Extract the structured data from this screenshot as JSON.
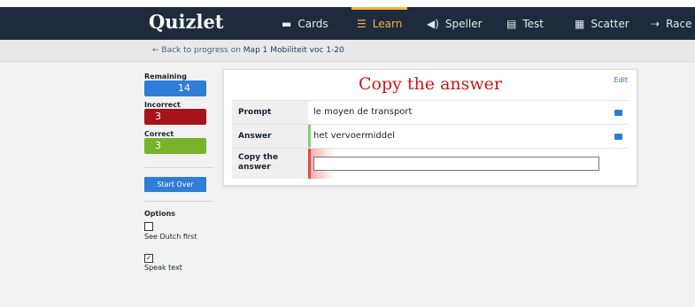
{
  "app": {
    "logo": "Quizlet"
  },
  "nav": [
    {
      "icon": "cards-icon",
      "glyph": "▬",
      "label": "Cards",
      "active": false
    },
    {
      "icon": "learn-icon",
      "glyph": "☰",
      "label": "Learn",
      "active": true
    },
    {
      "icon": "speaker-icon",
      "glyph": "◀)",
      "label": "Speller",
      "active": false
    },
    {
      "icon": "document-icon",
      "glyph": "▤",
      "label": "Test",
      "active": false
    },
    {
      "icon": "scatter-icon",
      "glyph": "▦",
      "label": "Scatter",
      "active": false
    },
    {
      "icon": "race-icon",
      "glyph": "⇢",
      "label": "Race",
      "active": false
    }
  ],
  "subbar": {
    "back_text": "← Back to progress on ",
    "set_name": "Map 1 Mobiliteit voc 1-20"
  },
  "sidebar": {
    "remaining_label": "Remaining",
    "remaining_value": "14",
    "incorrect_label": "Incorrect",
    "incorrect_value": "3",
    "correct_label": "Correct",
    "correct_value": "3",
    "start_over_label": "Start Over",
    "options_title": "Options",
    "options": [
      {
        "label": "See Dutch first",
        "checked": false
      },
      {
        "label": "Speak text",
        "checked": true
      }
    ]
  },
  "card": {
    "title": "Copy the answer",
    "edit_label": "Edit",
    "prompt_label": "Prompt",
    "prompt_value": "le moyen de transport",
    "answer_label": "Answer",
    "answer_value": "het vervoermiddel",
    "copy_label": "Copy the answer",
    "copy_input_value": ""
  },
  "colors": {
    "nav_bg": "#1f2b3d",
    "accent": "#f2b53b",
    "remaining": "#2e7dd6",
    "incorrect": "#a6141a",
    "correct": "#77b32b",
    "title_red": "#c41919"
  }
}
